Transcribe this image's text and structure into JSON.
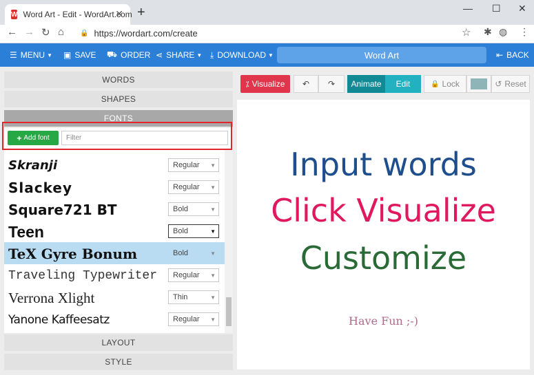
{
  "browser": {
    "tab_title": "Word Art - Edit - WordArt.com",
    "url": "https://wordart.com/create",
    "favicon_letter": "W"
  },
  "toolbar": {
    "menu": "MENU",
    "save": "SAVE",
    "order": "ORDER",
    "share": "SHARE",
    "download": "DOWNLOAD",
    "title": "Word Art",
    "back": "BACK"
  },
  "sections": {
    "words": "WORDS",
    "shapes": "SHAPES",
    "fonts": "FONTS",
    "layout": "LAYOUT",
    "style": "STYLE"
  },
  "fonts_panel": {
    "add_font_label": "Add font",
    "filter_placeholder": "Filter",
    "rows": [
      {
        "name": "Skranji",
        "weight": "Regular"
      },
      {
        "name": "Slackey",
        "weight": "Regular"
      },
      {
        "name": "Square721 BT",
        "weight": "Bold"
      },
      {
        "name": "Teen",
        "weight": "Bold"
      },
      {
        "name": "TeX Gyre Bonum",
        "weight": "Bold"
      },
      {
        "name": "Traveling Typewriter",
        "weight": "Regular"
      },
      {
        "name": "Verrona Xlight",
        "weight": "Thin"
      },
      {
        "name": "Yanone Kaffeesatz",
        "weight": "Regular"
      }
    ]
  },
  "actions": {
    "visualize": "Visualize",
    "animate": "Animate",
    "edit": "Edit",
    "lock": "Lock",
    "reset": "Reset"
  },
  "canvas": {
    "line1": "Input words",
    "line2": "Click Visualize",
    "line3": "Customize",
    "line4": "Have Fun ;-)"
  },
  "colors": {
    "toolbar_blue": "#2b7fd6",
    "visualize_red": "#e0354b",
    "animate_teal": "#128a96",
    "edit_teal": "#22b1c0",
    "add_green": "#28a745",
    "line1_color": "#1f4e8c",
    "line2_color": "#e0195f",
    "line3_color": "#2a6a36",
    "line4_color": "#b06a8a"
  }
}
